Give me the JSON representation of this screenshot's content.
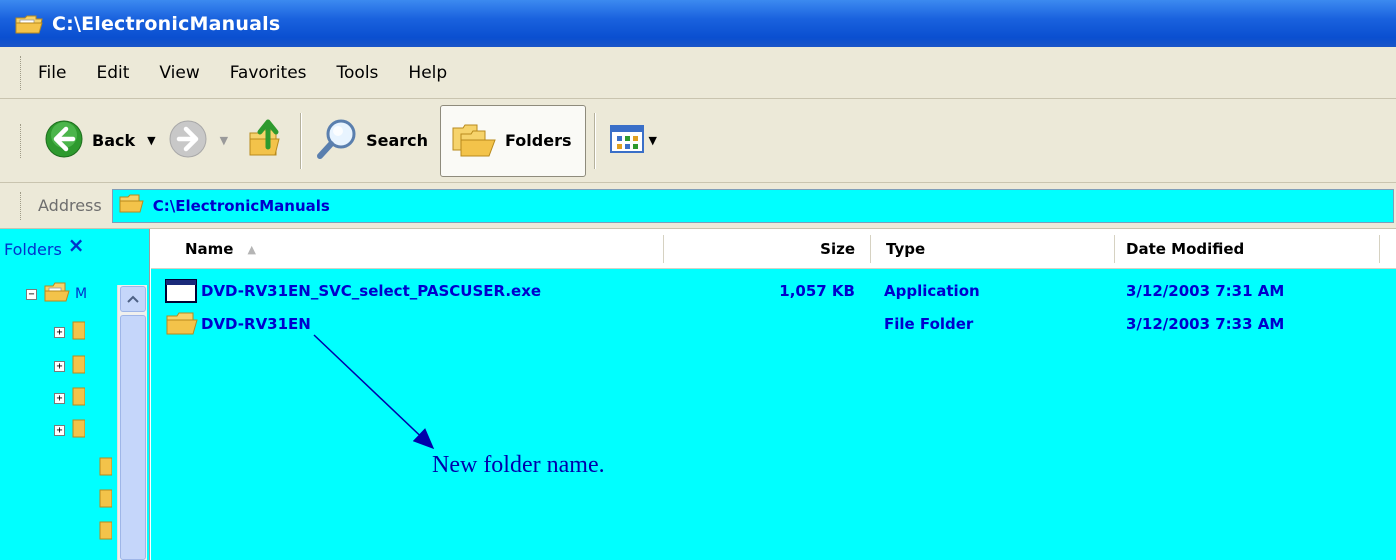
{
  "window": {
    "title": "C:\\ElectronicManuals"
  },
  "menu": [
    "File",
    "Edit",
    "View",
    "Favorites",
    "Tools",
    "Help"
  ],
  "toolbar": {
    "back_label": "Back",
    "search_label": "Search",
    "folders_label": "Folders"
  },
  "address": {
    "label": "Address",
    "value": "C:\\ElectronicManuals"
  },
  "folders_pane": {
    "title": "Folders",
    "close": "×",
    "root_label_fragment": "M"
  },
  "columns": {
    "name": "Name",
    "size": "Size",
    "type": "Type",
    "date": "Date Modified"
  },
  "files": [
    {
      "name": "DVD-RV31EN_SVC_select_PASCUSER.exe",
      "size": "1,057 KB",
      "type": "Application",
      "date": "3/12/2003 7:31 AM",
      "icon": "application-icon"
    },
    {
      "name": "DVD-RV31EN",
      "size": "",
      "type": "File Folder",
      "date": "3/12/2003 7:33 AM",
      "icon": "folder-icon"
    }
  ],
  "annotation": {
    "text": "New folder name."
  },
  "colors": {
    "highlight": "#00ffff",
    "text_blue": "#0000cc",
    "title_bar": "#0a4fd0"
  }
}
